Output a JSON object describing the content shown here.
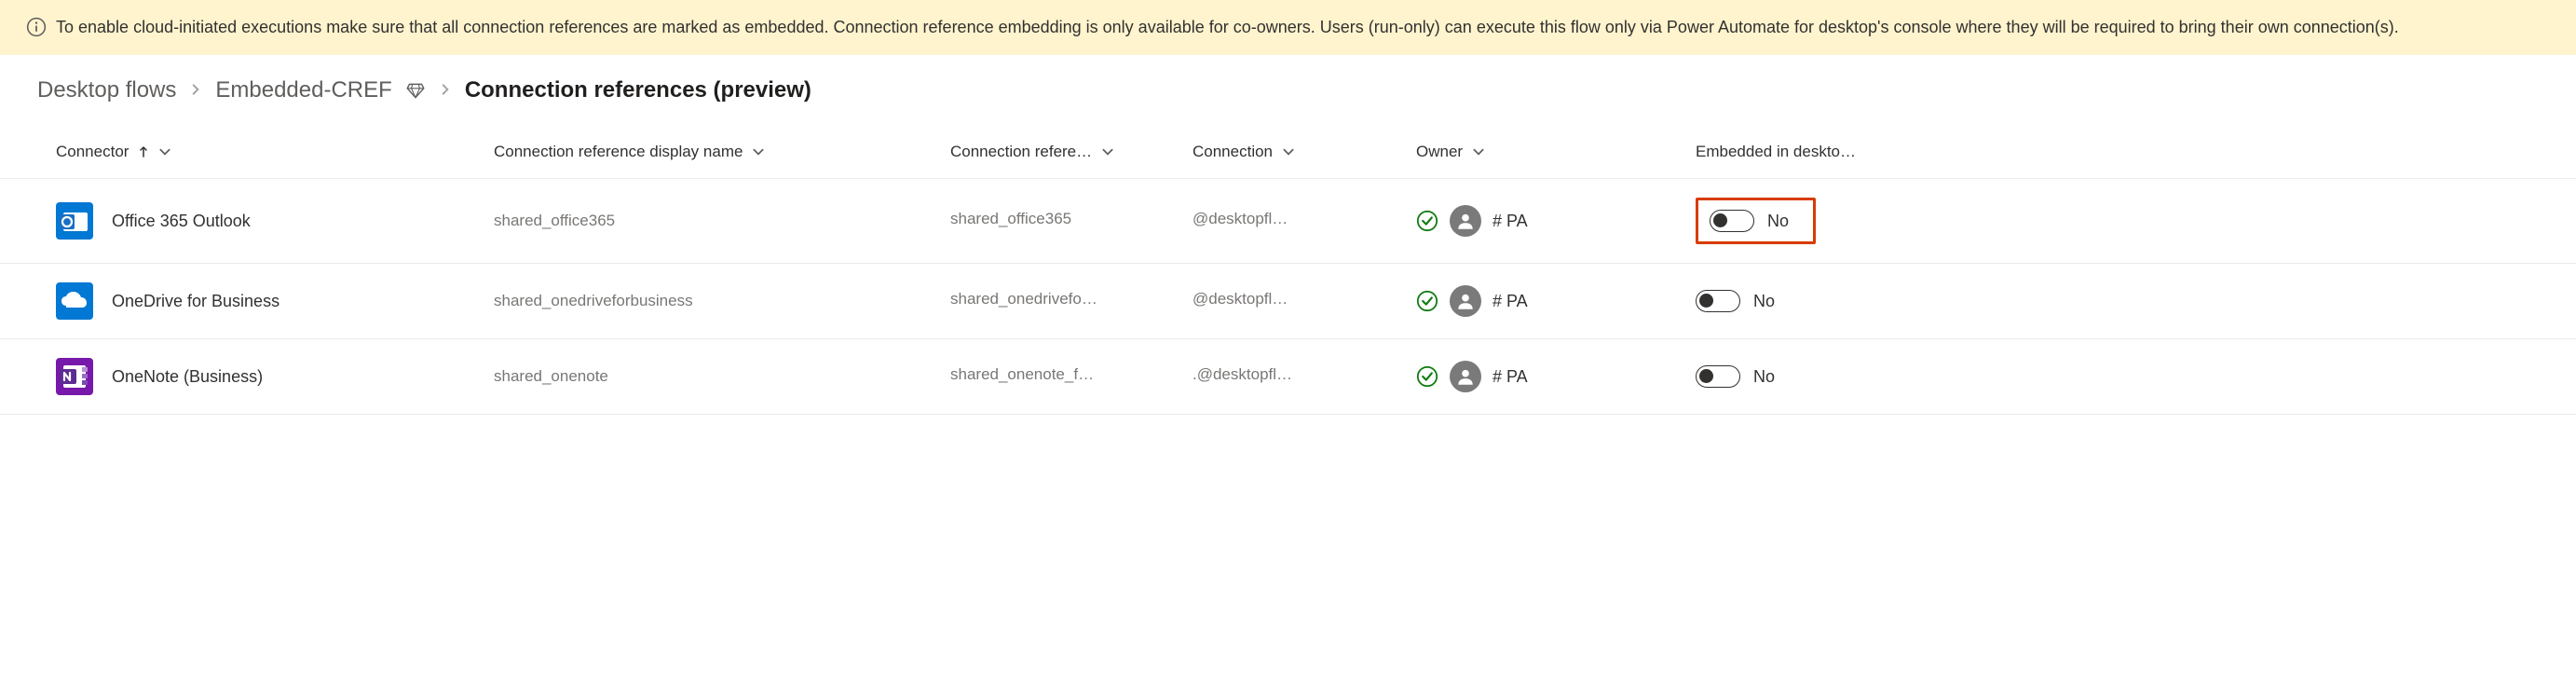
{
  "banner": {
    "text": "To enable cloud-initiated executions make sure that all connection references are marked as embedded. Connection reference embedding is only available for co-owners. Users (run-only) can execute this flow only via Power Automate for desktop's console where they will be required to bring their own connection(s)."
  },
  "breadcrumb": {
    "level1": "Desktop flows",
    "level2": "Embedded-CREF",
    "current": "Connection references (preview)"
  },
  "columns": {
    "connector": "Connector",
    "display_name": "Connection reference display name",
    "reference_name": "Connection refere…",
    "connection": "Connection",
    "owner": "Owner",
    "embedded": "Embedded in deskto…"
  },
  "rows": [
    {
      "connector": "Office 365 Outlook",
      "icon_bg": "#0078d4",
      "icon": "outlook",
      "display_name": "shared_office365",
      "reference_name": "shared_office365",
      "connection": "@desktopfl…",
      "owner": "# PA",
      "embedded_label": "No",
      "highlight": true
    },
    {
      "connector": "OneDrive for Business",
      "icon_bg": "#0078d4",
      "icon": "onedrive",
      "display_name": "shared_onedriveforbusiness",
      "reference_name": "shared_onedrivefo…",
      "connection": "@desktopfl…",
      "owner": "# PA",
      "embedded_label": "No",
      "highlight": false
    },
    {
      "connector": "OneNote (Business)",
      "icon_bg": "#7719aa",
      "icon": "onenote",
      "display_name": "shared_onenote",
      "reference_name": "shared_onenote_f…",
      "connection": ".@desktopfl…",
      "owner": "# PA",
      "embedded_label": "No",
      "highlight": false
    }
  ]
}
